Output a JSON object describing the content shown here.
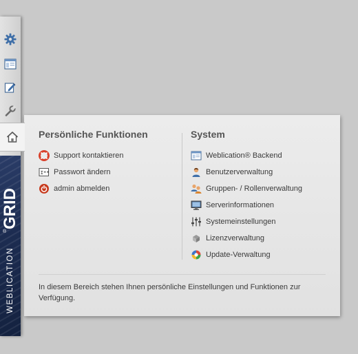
{
  "toolbar": {
    "items": [
      {
        "icon": "gear-icon"
      },
      {
        "icon": "window-icon"
      },
      {
        "icon": "edit-icon"
      },
      {
        "icon": "wrench-icon"
      },
      {
        "icon": "home-icon",
        "active": true
      }
    ]
  },
  "brand": {
    "grid": "GRID",
    "weblication": "WEBLICATION",
    "registered": "®"
  },
  "panel": {
    "personal": {
      "title": "Persönliche Funktionen",
      "items": [
        {
          "label": "Support kontaktieren",
          "icon": "lifebuoy-icon"
        },
        {
          "label": "Passwort ändern",
          "icon": "password-icon"
        },
        {
          "label": "admin abmelden",
          "icon": "power-icon"
        }
      ]
    },
    "system": {
      "title": "System",
      "items": [
        {
          "label": "Weblication® Backend",
          "icon": "backend-window-icon"
        },
        {
          "label": "Benutzerverwaltung",
          "icon": "user-icon"
        },
        {
          "label": "Gruppen- / Rollenverwaltung",
          "icon": "group-icon"
        },
        {
          "label": "Serverinformationen",
          "icon": "monitor-icon"
        },
        {
          "label": "Systemeinstellungen",
          "icon": "sliders-icon"
        },
        {
          "label": "Lizenzverwaltung",
          "icon": "license-icon"
        },
        {
          "label": "Update-Verwaltung",
          "icon": "update-icon"
        }
      ]
    },
    "info": "In diesem Bereich stehen Ihnen persönliche Einstellungen und Funktionen zur Verfügung."
  },
  "colors": {
    "background": "#c9c9c9",
    "brand": "#1d2d52",
    "accent_blue": "#3f6fa8"
  }
}
